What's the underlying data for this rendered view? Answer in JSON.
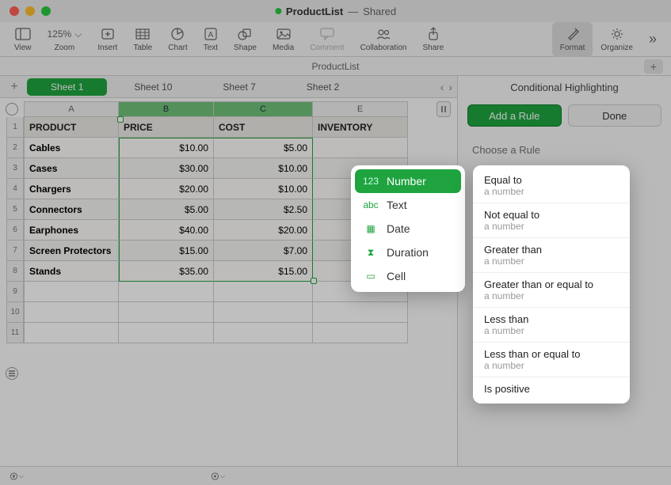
{
  "window": {
    "title": "ProductList",
    "shared": "Shared"
  },
  "toolbar": {
    "view": "View",
    "zoom_label": "Zoom",
    "zoom_value": "125%",
    "insert": "Insert",
    "table": "Table",
    "chart": "Chart",
    "text": "Text",
    "shape": "Shape",
    "media": "Media",
    "comment": "Comment",
    "collaboration": "Collaboration",
    "share": "Share",
    "format": "Format",
    "organize": "Organize"
  },
  "docbar": {
    "name": "ProductList"
  },
  "sheets": {
    "items": [
      "Sheet 1",
      "Sheet 10",
      "Sheet 7",
      "Sheet 2"
    ],
    "active": 0
  },
  "columns": [
    "A",
    "B",
    "C",
    "E"
  ],
  "table": {
    "headers": [
      "PRODUCT",
      "PRICE",
      "COST",
      "INVENTORY"
    ],
    "rows": [
      {
        "product": "Cables",
        "price": "$10.00",
        "cost": "$5.00"
      },
      {
        "product": "Cases",
        "price": "$30.00",
        "cost": "$10.00"
      },
      {
        "product": "Chargers",
        "price": "$20.00",
        "cost": "$10.00"
      },
      {
        "product": "Connectors",
        "price": "$5.00",
        "cost": "$2.50"
      },
      {
        "product": "Earphones",
        "price": "$40.00",
        "cost": "$20.00"
      },
      {
        "product": "Screen Protectors",
        "price": "$15.00",
        "cost": "$7.00"
      },
      {
        "product": "Stands",
        "price": "$35.00",
        "cost": "$15.00"
      }
    ]
  },
  "empty_row_labels": [
    "9",
    "10",
    "11"
  ],
  "sidebar": {
    "title": "Conditional Highlighting",
    "add_rule": "Add a Rule",
    "done": "Done"
  },
  "popover": {
    "choose": "Choose a Rule",
    "categories": [
      {
        "icon": "123",
        "label": "Number"
      },
      {
        "icon": "abc",
        "label": "Text"
      },
      {
        "icon": "▦",
        "label": "Date"
      },
      {
        "icon": "⧗",
        "label": "Duration"
      },
      {
        "icon": "▭",
        "label": "Cell"
      }
    ],
    "rules": [
      {
        "name": "Equal to",
        "sub": "a number"
      },
      {
        "name": "Not equal to",
        "sub": "a number"
      },
      {
        "name": "Greater than",
        "sub": "a number"
      },
      {
        "name": "Greater than or equal to",
        "sub": "a number"
      },
      {
        "name": "Less than",
        "sub": "a number"
      },
      {
        "name": "Less than or equal to",
        "sub": "a number"
      },
      {
        "name": "Is positive",
        "sub": ""
      }
    ]
  }
}
